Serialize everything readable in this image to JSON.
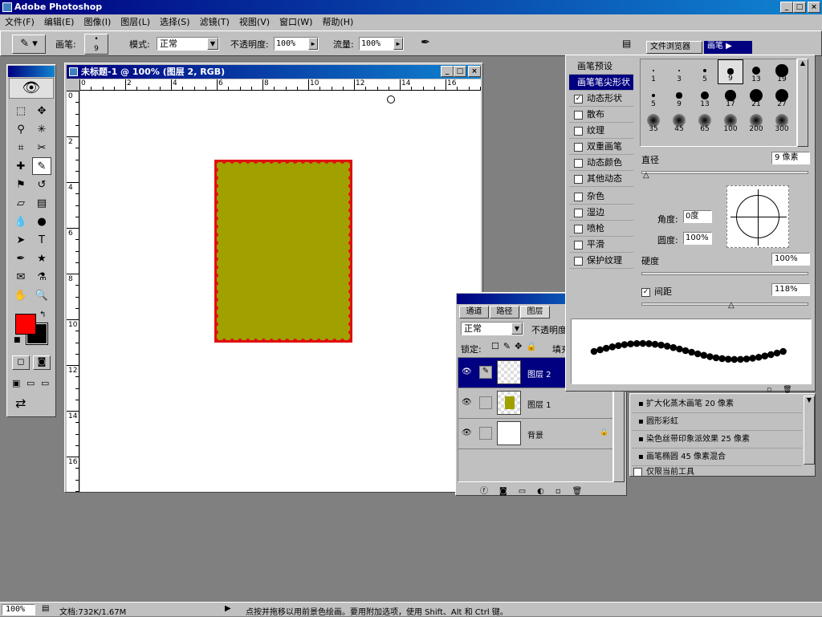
{
  "app": {
    "title": "Adobe Photoshop"
  },
  "menu": [
    "文件(F)",
    "编辑(E)",
    "图像(I)",
    "图层(L)",
    "选择(S)",
    "滤镜(T)",
    "视图(V)",
    "窗口(W)",
    "帮助(H)"
  ],
  "options": {
    "brush_label": "画笔:",
    "brush_size": "9",
    "mode_label": "模式:",
    "mode_value": "正常",
    "opacity_label": "不透明度:",
    "opacity_value": "100%",
    "flow_label": "流量:",
    "flow_value": "100%"
  },
  "palette_well": {
    "tab1": "文件浏览器",
    "tab2": "画笔"
  },
  "document": {
    "title": "未标题-1 @ 100% (图层 2, RGB)",
    "ruler_h": [
      "0",
      "2",
      "4",
      "6",
      "8",
      "10",
      "12",
      "14",
      "16"
    ],
    "ruler_v": [
      "0",
      "2",
      "4",
      "6",
      "8",
      "10",
      "12",
      "14",
      "16"
    ],
    "fill_color": "#a0a000",
    "border_color": "#e01010"
  },
  "brushes": {
    "sidebar": [
      "画笔预设",
      "画笔笔尖形状",
      "动态形状",
      "散布",
      "纹理",
      "双重画笔",
      "动态颜色",
      "其他动态",
      "杂色",
      "湿边",
      "喷枪",
      "平滑",
      "保护纹理"
    ],
    "checked": [
      false,
      false,
      true,
      false,
      false,
      false,
      false,
      false,
      false,
      false,
      false,
      false,
      false
    ],
    "tips": [
      "1",
      "3",
      "5",
      "9",
      "13",
      "19",
      "5",
      "9",
      "13",
      "17",
      "21",
      "27",
      "35",
      "45",
      "65",
      "100",
      "200",
      "300"
    ],
    "diameter_label": "直径",
    "diameter_value": "9 像素",
    "angle_label": "角度:",
    "angle_value": "0度",
    "roundness_label": "圆度:",
    "roundness_value": "100%",
    "hardness_label": "硬度",
    "hardness_value": "100%",
    "spacing_label": "间距",
    "spacing_value": "118%"
  },
  "presets": {
    "items": [
      "扩大化蒸木画笔 20 像素",
      "圆形彩虹",
      "染色丝带印象派效果 25 像素",
      "画笔椭圆 45 像素混合"
    ],
    "only_current": "仅限当前工具"
  },
  "layers": {
    "tabs": [
      "通道",
      "路径",
      "图层"
    ],
    "mode": "正常",
    "opacity_label": "不透明度",
    "lock_label": "锁定:",
    "fill_label": "填充",
    "rows": [
      "图层 2",
      "图层 1",
      "背景"
    ]
  },
  "status": {
    "zoom": "100%",
    "doc": "文档:732K/1.67M",
    "hint": "点按并拖移以用前景色绘画。要用附加选项，使用 Shift、Alt 和 Ctrl 键。"
  },
  "colors": {
    "foreground": "#ff0000",
    "background": "#000000"
  }
}
